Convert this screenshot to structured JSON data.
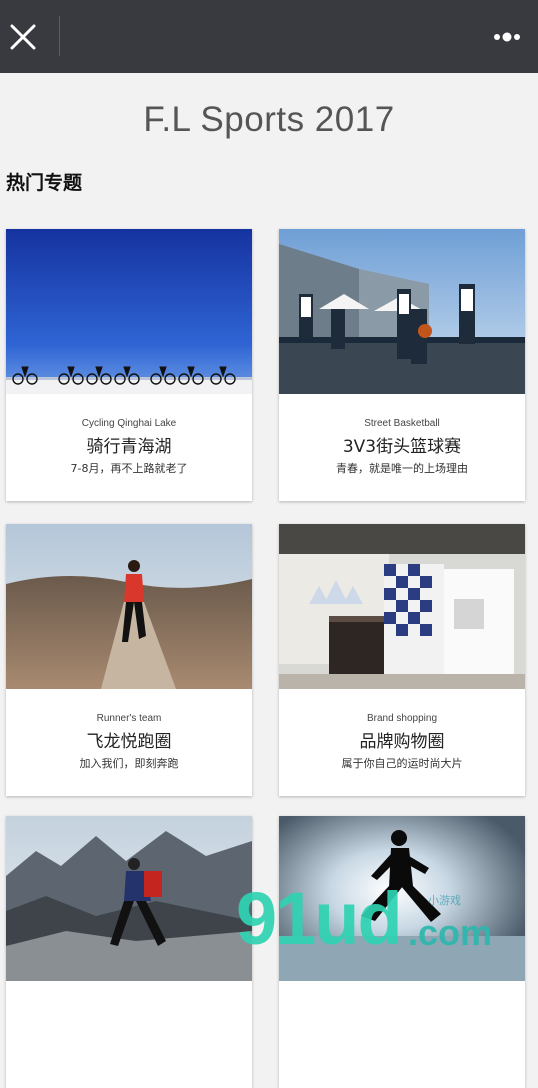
{
  "topbar": {
    "close_icon": "close-icon",
    "more_icon": "more-dots-icon",
    "bg_color": "#393a3f"
  },
  "page": {
    "title": "F.L Sports 2017",
    "section_heading": "热门专题"
  },
  "cards": [
    {
      "en": "Cycling Qinghai Lake",
      "zh": "骑行青海湖",
      "desc": "7-8月，再不上路就老了"
    },
    {
      "en": "Street Basketball",
      "zh": "3V3街头篮球赛",
      "desc": "青春，就是唯一的上场理由"
    },
    {
      "en": "Runner's team",
      "zh": "飞龙悦跑圈",
      "desc": "加入我们，即刻奔跑"
    },
    {
      "en": "Brand shopping",
      "zh": "品牌购物圈",
      "desc": "属于你自己的运时尚大片"
    },
    {
      "en": "",
      "zh": "",
      "desc": ""
    },
    {
      "en": "",
      "zh": "",
      "desc": ""
    }
  ],
  "watermark": {
    "main": "91ud",
    "suffix": ".com",
    "tagline": "小游戏"
  }
}
